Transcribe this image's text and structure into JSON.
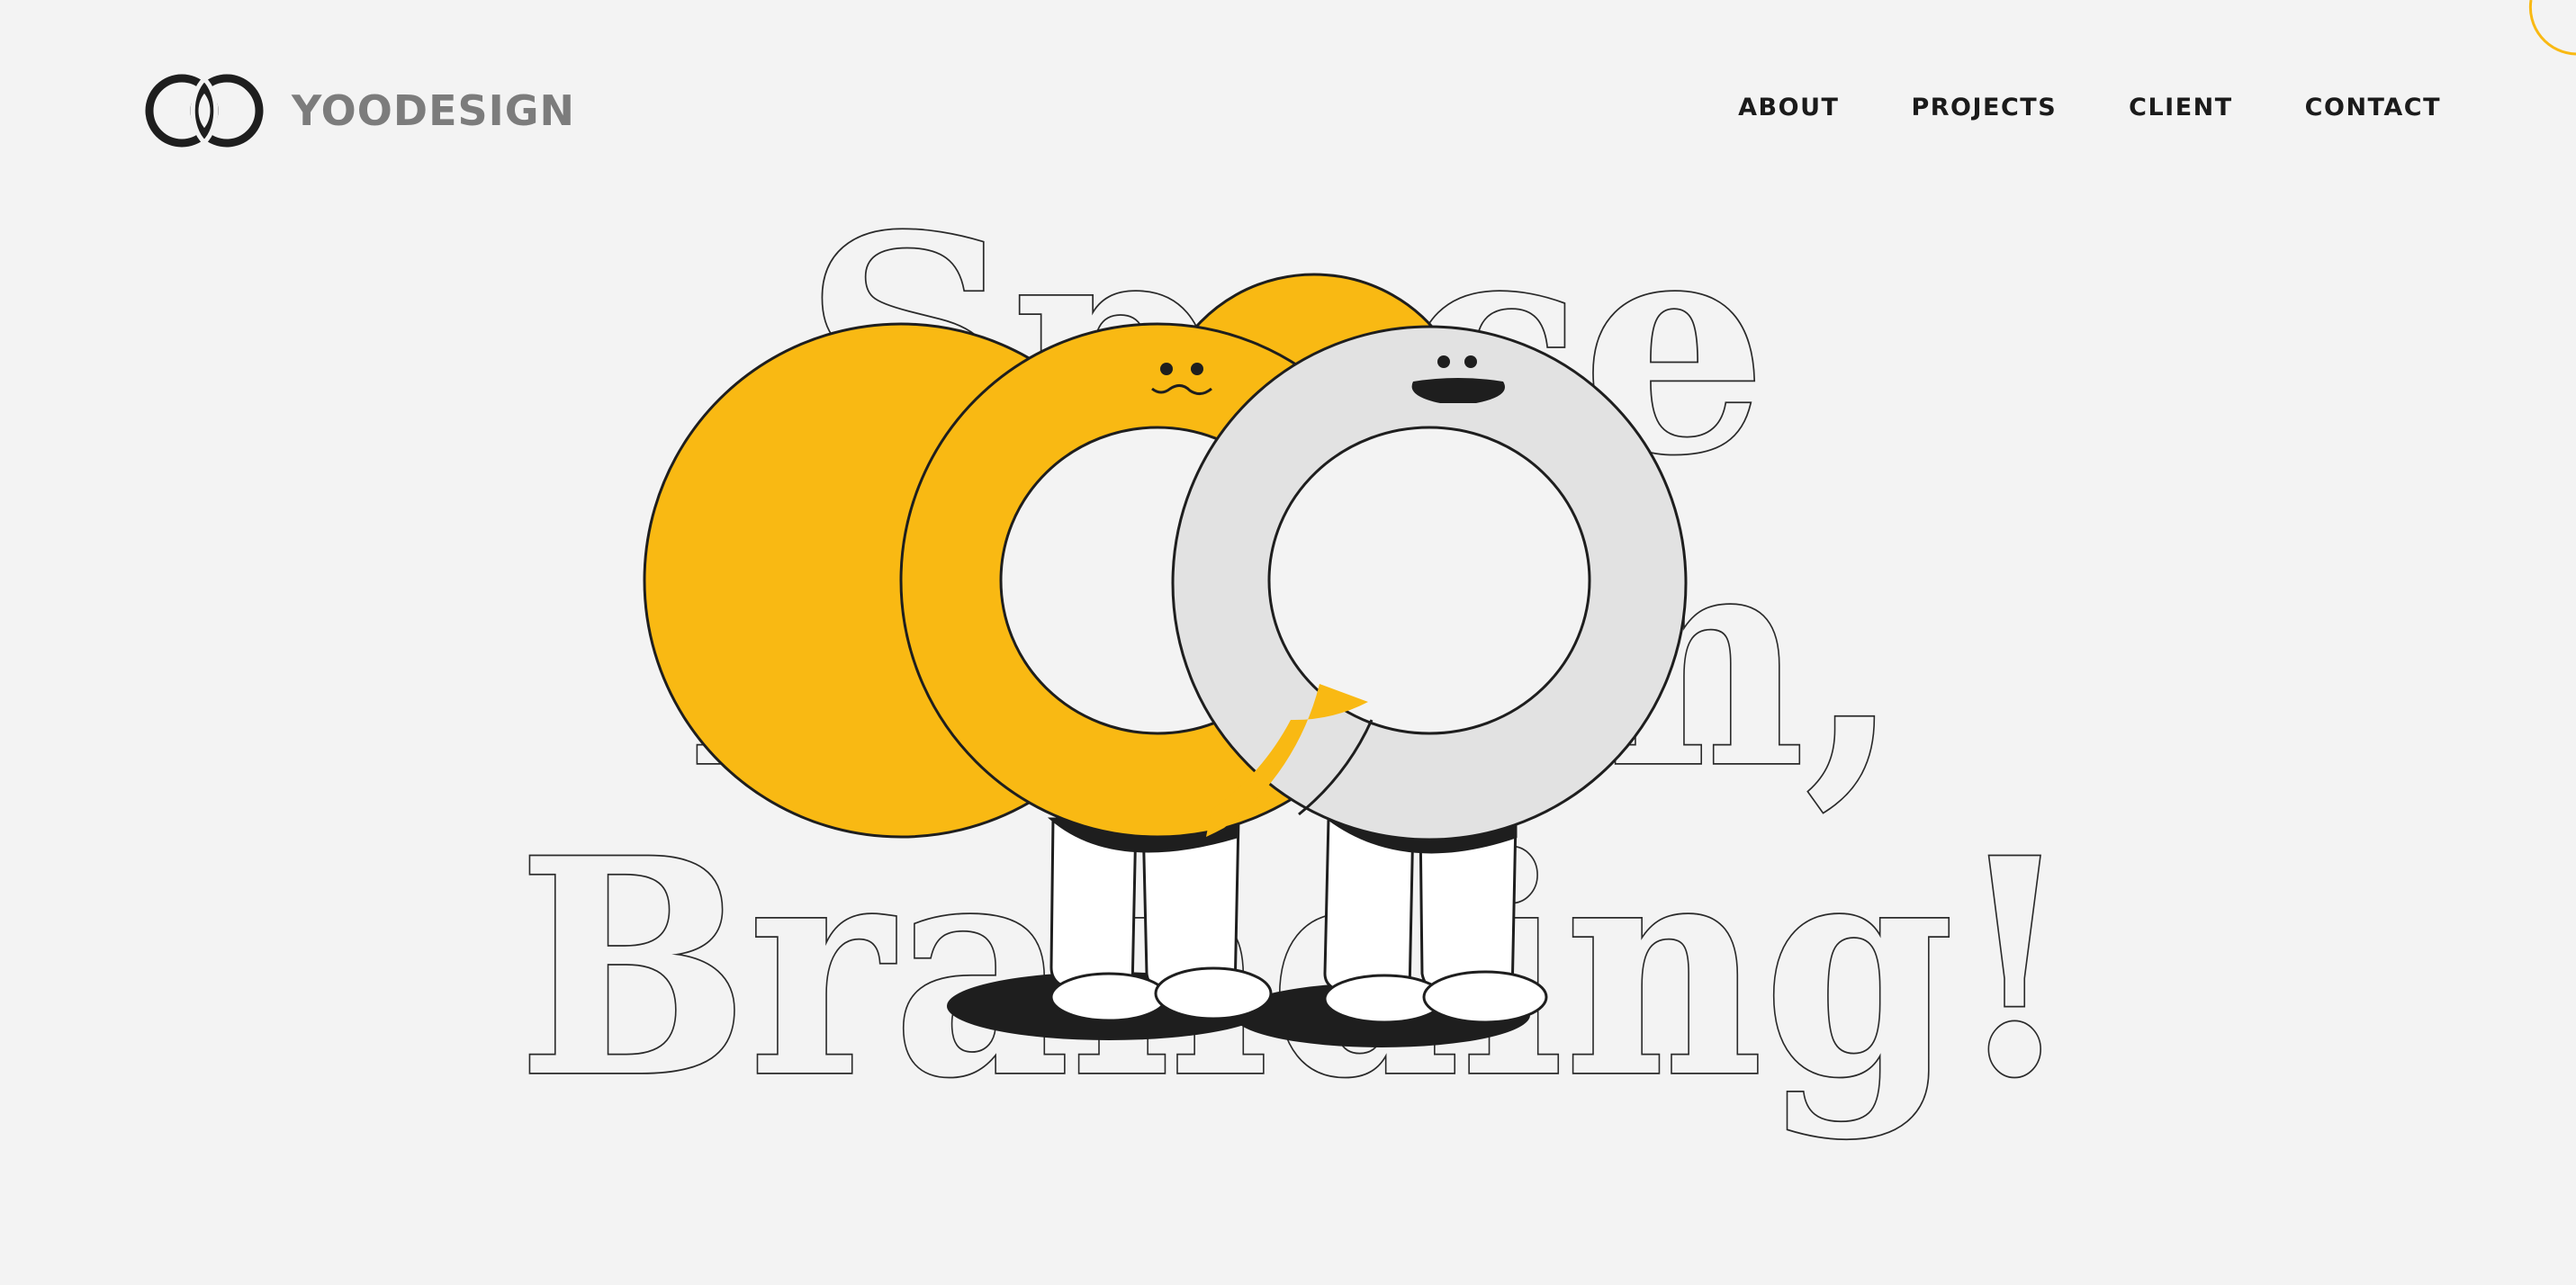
{
  "brand": {
    "name": "YOODESIGN",
    "logo_icon": "interlocked-rings-icon"
  },
  "nav": {
    "items": [
      {
        "label": "ABOUT"
      },
      {
        "label": "PROJECTS"
      },
      {
        "label": "CLIENT"
      },
      {
        "label": "CONTACT"
      }
    ]
  },
  "hero": {
    "line1": "Space",
    "line2": "Human,",
    "line3": "Branding!",
    "illustration": "two-ring-mascots-illustration"
  },
  "colors": {
    "background": "#f3f3f3",
    "accent_yellow": "#f9b913",
    "ring_gray": "#e2e2e2",
    "ink": "#1e1e1e",
    "logo_text": "#7c7c7c"
  }
}
